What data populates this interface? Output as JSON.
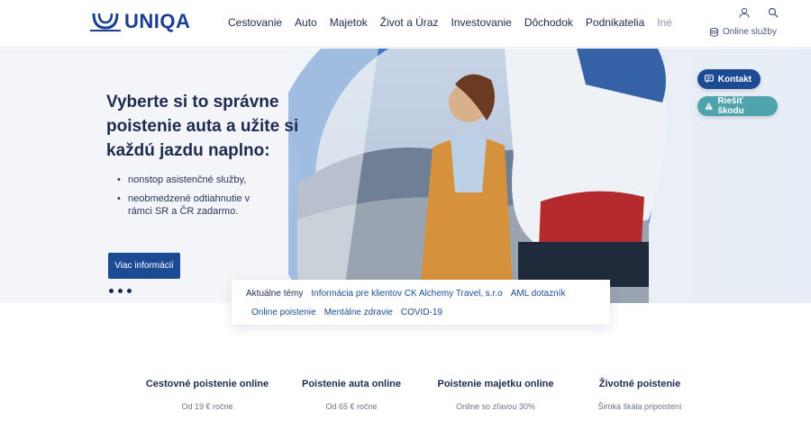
{
  "header": {
    "logo_text": "UNIQA",
    "nav": [
      "Cestovanie",
      "Auto",
      "Majetok",
      "Život a Úraz",
      "Investovanie",
      "Dôchodok",
      "Podnikatelia",
      "Iné"
    ],
    "online_services": "Online služby",
    "icons": [
      "user-icon",
      "search-icon",
      "database-icon"
    ]
  },
  "hero": {
    "title": "Vyberte si to správne poistenie auta a užite si každú jazdu naplno:",
    "bullets": [
      "nonstop asistenčné služby,",
      "neobmedzené odtiahnutie v rámci SR a ČR zadarmo."
    ],
    "button": "Viac informácií",
    "slides": 3,
    "accent_color": "#1d4b93"
  },
  "floating": {
    "contact": "Kontakt",
    "claim": "Riešiť škodu",
    "contact_color": "#1d4b93",
    "claim_color": "#4fa3ad"
  },
  "topics": {
    "label": "Aktuálne témy",
    "links": [
      "Informácia pre klientov CK Alchemy Travel, s.r.o",
      "AML dotazník",
      "Online poistenie",
      "Mentálne zdravie",
      "COVID-19"
    ]
  },
  "products": [
    {
      "title": "Cestovné poistenie online",
      "subtitle": "Od 19 € ročne"
    },
    {
      "title": "Poistenie auta online",
      "subtitle": "Od 65 € ročne"
    },
    {
      "title": "Poistenie majetku online",
      "subtitle": "Online so zľavou 30%"
    },
    {
      "title": "Životné poistenie",
      "subtitle": "Široká škála pripoistení"
    }
  ]
}
